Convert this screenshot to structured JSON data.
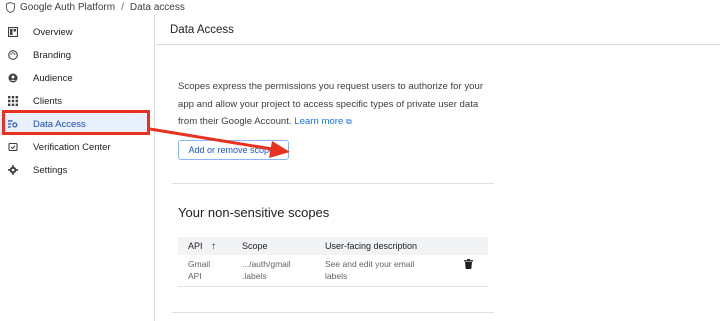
{
  "breadcrumb": {
    "root": "Google Auth Platform",
    "separator": "/",
    "current": "Data access"
  },
  "sidebar": {
    "items": [
      {
        "label": "Overview",
        "icon": "dashboard-icon"
      },
      {
        "label": "Branding",
        "icon": "palette-icon"
      },
      {
        "label": "Audience",
        "icon": "person-icon"
      },
      {
        "label": "Clients",
        "icon": "grid-icon"
      },
      {
        "label": "Data Access",
        "icon": "data-access-icon",
        "active": true
      },
      {
        "label": "Verification Center",
        "icon": "verification-icon"
      },
      {
        "label": "Settings",
        "icon": "gear-icon"
      }
    ]
  },
  "main": {
    "title": "Data Access",
    "description": "Scopes express the permissions you request users to authorize for your app and allow your project to access specific types of private user data from their Google Account.",
    "learn_more": "Learn more",
    "add_scopes_button": "Add or remove scopes",
    "non_sensitive": {
      "title": "Your non-sensitive scopes",
      "columns": [
        "API",
        "Scope",
        "User-facing description"
      ],
      "sort_icon": "arrow-up-icon",
      "rows": [
        {
          "api_line1": "Gmail",
          "api_line2": "API",
          "scope_line1": ".../auth/gmail",
          "scope_line2": ".labels",
          "desc_line1": "See and edit your email",
          "desc_line2": "labels"
        }
      ]
    }
  },
  "colors": {
    "accent": "#1a73e8",
    "active_bg": "#e8f0fe",
    "annotation": "#e8321f"
  }
}
